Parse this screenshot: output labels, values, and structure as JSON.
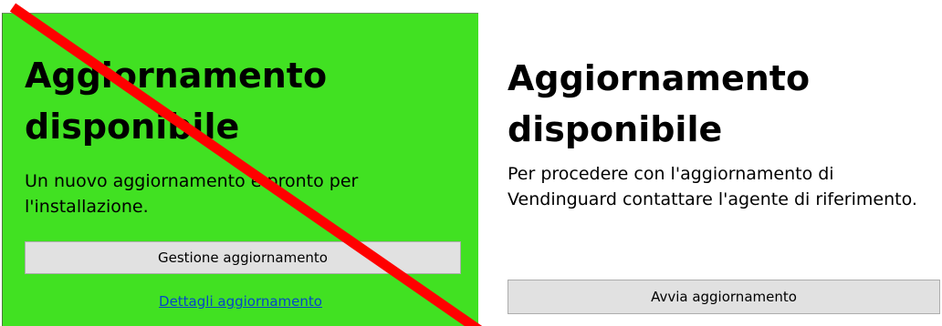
{
  "left_panel": {
    "title": "Aggiornamento disponibile",
    "message": "Un nuovo aggiornamento è pronto per l'installazione.",
    "button_label": "Gestione aggiornamento",
    "link_label": "Dettagli aggiornamento",
    "background_color": "#41e122"
  },
  "right_panel": {
    "title": "Aggiornamento disponibile",
    "message": "Per procedere con l'aggiornamento di Vendinguard contattare l'agente di riferimento.",
    "button_label": "Avvia aggiornamento"
  },
  "overlay": {
    "icon": "strike-through-line",
    "color": "#ff0000"
  }
}
